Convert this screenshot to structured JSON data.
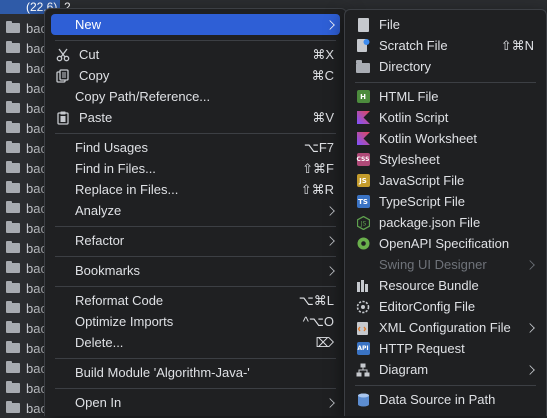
{
  "tree": {
    "first_row_label": "(22.6)_2",
    "row_label": "bac",
    "row_count": 20
  },
  "main_menu": {
    "items": [
      {
        "label": "New",
        "shortcut": "",
        "submenu": true,
        "icon": "",
        "selected": true
      },
      {
        "label": "Cut",
        "shortcut": "⌘X",
        "icon": "scissors-icon"
      },
      {
        "label": "Copy",
        "shortcut": "⌘C",
        "icon": "copy-icon"
      },
      {
        "label": "Copy Path/Reference...",
        "shortcut": "",
        "icon": ""
      },
      {
        "label": "Paste",
        "shortcut": "⌘V",
        "icon": "clipboard-icon"
      },
      {
        "label": "Find Usages",
        "shortcut": "⌥F7",
        "icon": ""
      },
      {
        "label": "Find in Files...",
        "shortcut": "⇧⌘F",
        "icon": ""
      },
      {
        "label": "Replace in Files...",
        "shortcut": "⇧⌘R",
        "icon": ""
      },
      {
        "label": "Analyze",
        "shortcut": "",
        "submenu": true,
        "icon": ""
      },
      {
        "label": "Refactor",
        "shortcut": "",
        "submenu": true,
        "icon": ""
      },
      {
        "label": "Bookmarks",
        "shortcut": "",
        "submenu": true,
        "icon": ""
      },
      {
        "label": "Reformat Code",
        "shortcut": "⌥⌘L",
        "icon": ""
      },
      {
        "label": "Optimize Imports",
        "shortcut": "^⌥O",
        "icon": ""
      },
      {
        "label": "Delete...",
        "shortcut": "⌦",
        "icon": ""
      },
      {
        "label": "Build Module 'Algorithm-Java-'",
        "shortcut": "",
        "icon": ""
      },
      {
        "label": "Open In",
        "shortcut": "",
        "submenu": true,
        "icon": ""
      }
    ]
  },
  "new_menu": {
    "items": [
      {
        "label": "File",
        "shortcut": "",
        "icon": "file-icon"
      },
      {
        "label": "Scratch File",
        "shortcut": "⇧⌘N",
        "icon": "scratch-file-icon"
      },
      {
        "label": "Directory",
        "shortcut": "",
        "icon": "folder-icon"
      },
      {
        "label": "HTML File",
        "shortcut": "",
        "icon": "html-file-icon"
      },
      {
        "label": "Kotlin Script",
        "shortcut": "",
        "icon": "kotlin-script-icon"
      },
      {
        "label": "Kotlin Worksheet",
        "shortcut": "",
        "icon": "kotlin-worksheet-icon"
      },
      {
        "label": "Stylesheet",
        "shortcut": "",
        "icon": "css-file-icon"
      },
      {
        "label": "JavaScript File",
        "shortcut": "",
        "icon": "javascript-file-icon"
      },
      {
        "label": "TypeScript File",
        "shortcut": "",
        "icon": "typescript-file-icon"
      },
      {
        "label": "package.json File",
        "shortcut": "",
        "icon": "nodejs-icon"
      },
      {
        "label": "OpenAPI Specification",
        "shortcut": "",
        "icon": "openapi-icon"
      },
      {
        "label": "Swing UI Designer",
        "shortcut": "",
        "submenu": true,
        "disabled": true,
        "icon": ""
      },
      {
        "label": "Resource Bundle",
        "shortcut": "",
        "icon": "resource-bundle-icon"
      },
      {
        "label": "EditorConfig File",
        "shortcut": "",
        "icon": "editorconfig-icon"
      },
      {
        "label": "XML Configuration File",
        "shortcut": "",
        "submenu": true,
        "icon": "xml-config-icon"
      },
      {
        "label": "HTTP Request",
        "shortcut": "",
        "icon": "http-request-icon"
      },
      {
        "label": "Diagram",
        "shortcut": "",
        "submenu": true,
        "icon": "diagram-icon"
      },
      {
        "label": "Data Source in Path",
        "shortcut": "",
        "icon": "database-icon"
      }
    ]
  },
  "colors": {
    "menu_bg": "#1f2022",
    "selection": "#2e5fd6",
    "tree_selection": "#2f5ba8",
    "text": "#dfe1e5",
    "disabled_text": "#6f737a"
  }
}
